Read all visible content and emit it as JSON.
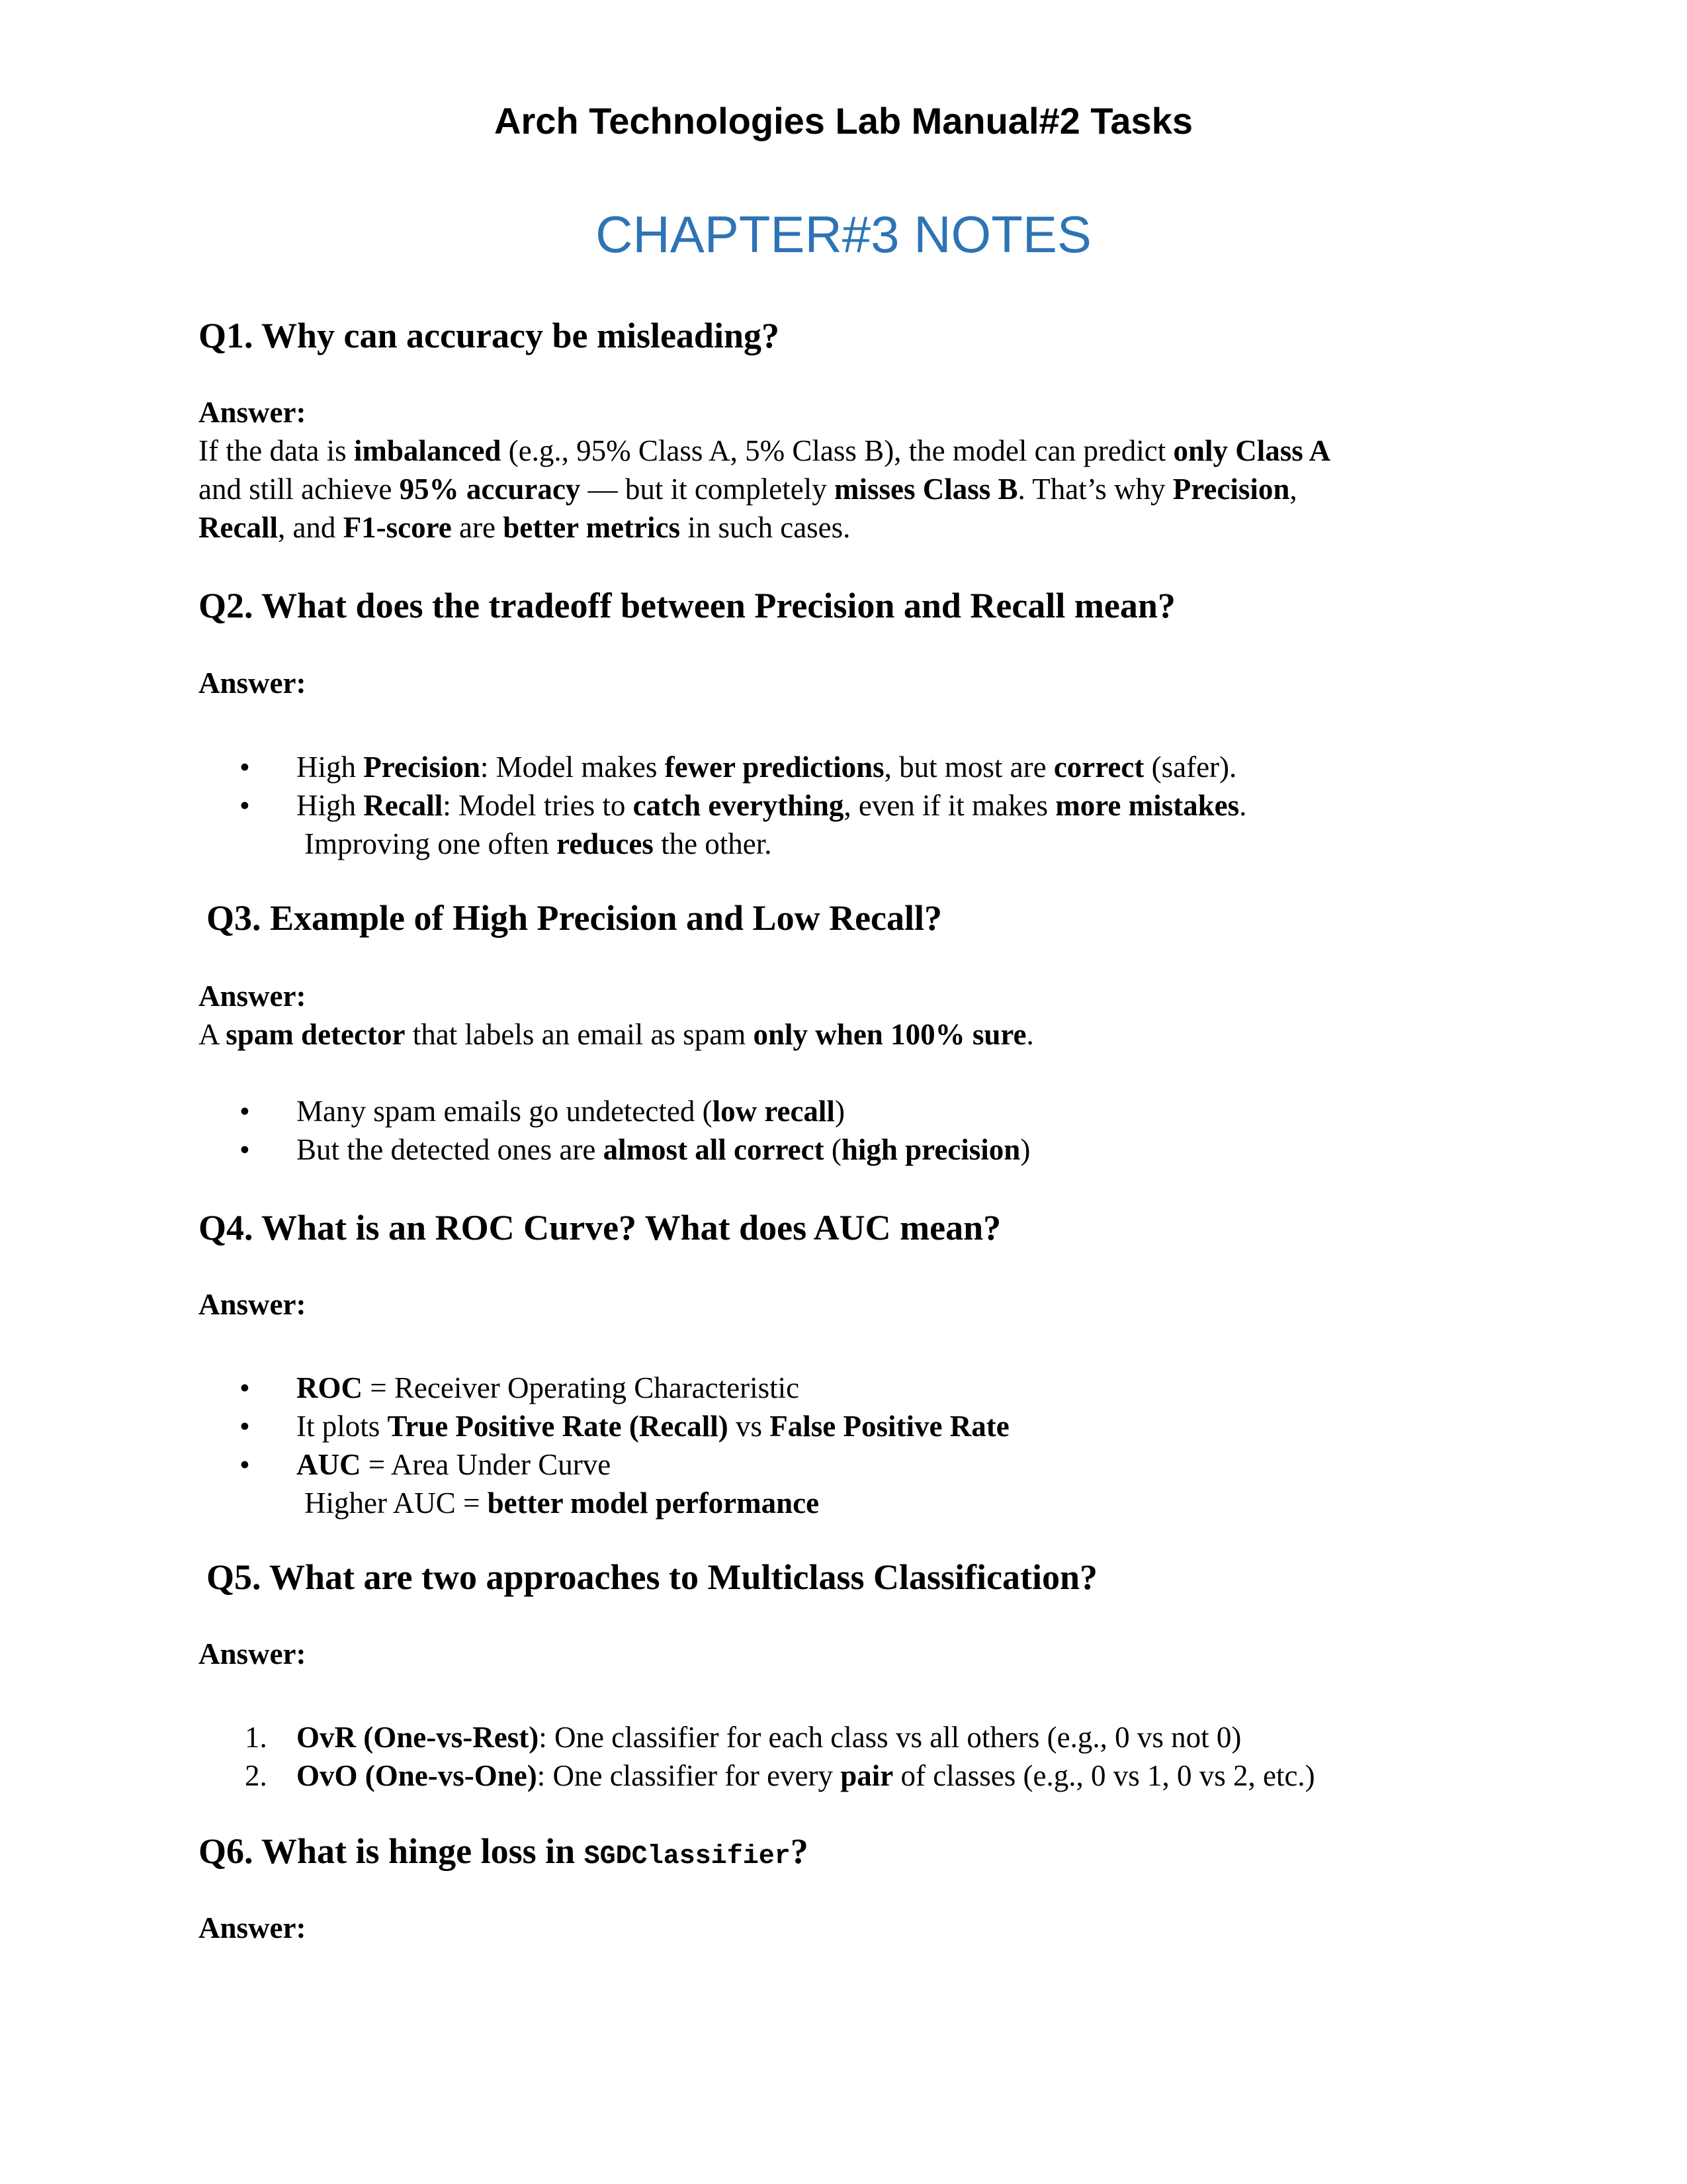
{
  "header": {
    "title": "Arch Technologies Lab Manual#2 Tasks",
    "chapter": "CHAPTER#3 NOTES",
    "chapter_color": "#2E74B5"
  },
  "answer_label": "Answer:",
  "bullet_glyph": "•",
  "q1": {
    "question": "Q1. Why can accuracy be misleading?",
    "l1": [
      "If the data is ",
      "imbalanced",
      " (e.g., 95% Class A, 5% Class B), the model can predict ",
      "only Class A"
    ],
    "l2": [
      "and still achieve ",
      "95% accuracy",
      " — but it completely ",
      "misses Class B",
      ". That’s why ",
      "Precision",
      ","
    ],
    "l3": [
      "Recall",
      ", and ",
      "F1-score",
      " are ",
      "better metrics",
      " in such cases."
    ]
  },
  "q2": {
    "question": "Q2. What does the tradeoff between Precision and Recall mean?",
    "b1": [
      "High ",
      "Precision",
      ": Model makes ",
      "fewer predictions",
      ", but most are ",
      "correct",
      " (safer)."
    ],
    "b2": [
      "High ",
      "Recall",
      ": Model tries to ",
      "catch everything",
      ", even if it makes ",
      "more mistakes",
      "."
    ],
    "cont": [
      "Improving one often ",
      "reduces",
      " the other."
    ]
  },
  "q3": {
    "question": "Q3. Example of High Precision and Low Recall?",
    "l1": [
      "A ",
      "spam detector",
      " that labels an email as spam ",
      "only when 100% sure",
      "."
    ],
    "b1": [
      "Many spam emails go undetected (",
      "low recall",
      ")"
    ],
    "b2": [
      "But the detected ones are ",
      "almost all correct",
      " (",
      "high precision",
      ")"
    ]
  },
  "q4": {
    "question": "Q4. What is an ROC Curve? What does AUC mean?",
    "b1": [
      "ROC",
      " = Receiver Operating Characteristic"
    ],
    "b2": [
      "It plots ",
      "True Positive Rate (Recall)",
      " vs ",
      "False Positive Rate"
    ],
    "b3": [
      "AUC",
      " = Area Under Curve"
    ],
    "cont": [
      "Higher AUC = ",
      "better model performance"
    ]
  },
  "q5": {
    "question": "Q5. What are two approaches to Multiclass Classification?",
    "n1_marker": "1.",
    "n1": [
      "OvR (One-vs-Rest)",
      ": One classifier for each class vs all others (e.g., 0 vs not 0)"
    ],
    "n2_marker": "2.",
    "n2": [
      "OvO (One-vs-One)",
      ": One classifier for every ",
      "pair",
      " of classes (e.g., 0 vs 1, 0 vs 2, etc.)"
    ]
  },
  "q6": {
    "question_prefix": "Q6. What is hinge loss in ",
    "question_code": "SGDClassifier",
    "question_suffix": "?"
  }
}
